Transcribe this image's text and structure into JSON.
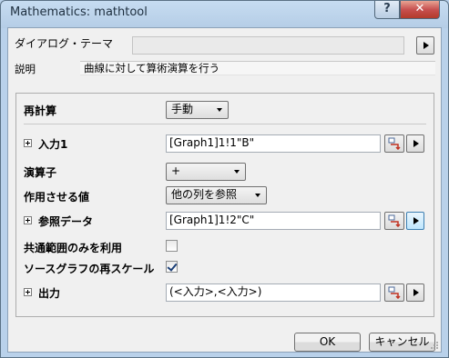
{
  "window": {
    "title": "Mathematics: mathtool",
    "help_label": "?",
    "close_label": "✕"
  },
  "dialog_theme": {
    "label": "ダイアログ・テーマ",
    "value": ""
  },
  "description": {
    "label": "説明",
    "value": "曲線に対して算術演算を行う"
  },
  "recalc": {
    "label": "再計算",
    "value": "手動"
  },
  "input1": {
    "label": "入力1",
    "value": "[Graph1]1!1\"B\""
  },
  "operator": {
    "label": "演算子",
    "value": "+"
  },
  "operand": {
    "label": "作用させる値",
    "value": "他の列を参照"
  },
  "reference": {
    "label": "参照データ",
    "value": "[Graph1]1!2\"C\""
  },
  "common_range": {
    "label": "共通範囲のみを利用",
    "checked": false
  },
  "rescale": {
    "label": "ソースグラフの再スケール",
    "checked": true
  },
  "output": {
    "label": "出力",
    "value": "(<入力>,<入力>)"
  },
  "buttons": {
    "ok": "OK",
    "cancel": "キャンセル"
  }
}
